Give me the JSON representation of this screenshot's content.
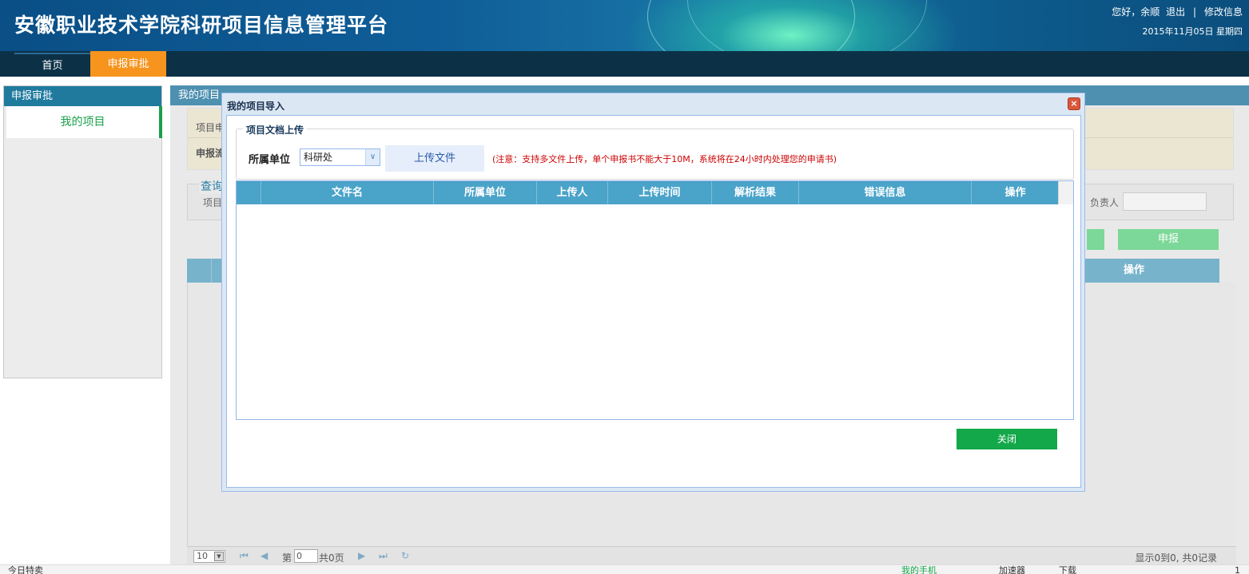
{
  "header": {
    "title": "安徽职业技术学院科研项目信息管理平台",
    "greeting": "您好，余顺",
    "logout": "退出",
    "separator": "|",
    "edit_info": "修改信息",
    "date": "2015年11月05日  星期四"
  },
  "nav": {
    "tabs": [
      {
        "label": "首页",
        "active": false
      },
      {
        "label": "申报审批",
        "active": true
      }
    ]
  },
  "sidebar": {
    "title": "申报审批",
    "items": [
      {
        "label": "我的项目",
        "active": true
      }
    ]
  },
  "main": {
    "title": "我的项目",
    "info_line1": "项目申",
    "info_line2": "申报流",
    "query_legend": "查询",
    "query_field_label": "项目",
    "owner_label": "负责人",
    "owner_value": "",
    "declare_button": "申报",
    "grid_op_header": "操作",
    "pager": {
      "page_size": "10",
      "page_prefix": "第",
      "page_value": "0",
      "page_total": "共0页",
      "summary": "显示0到0, 共0记录"
    }
  },
  "modal": {
    "title": "我的项目导入",
    "close_icon": "close-icon",
    "fieldset_legend": "项目文档上传",
    "unit_label": "所属单位",
    "unit_selected": "科研处",
    "upload_button": "上传文件",
    "note": "(注意：支持多文件上传，单个申报书不能大于10M，系统将在24小时内处理您的申请书)",
    "columns": [
      "文件名",
      "所属单位",
      "上传人",
      "上传时间",
      "解析结果",
      "错误信息",
      "操作"
    ],
    "rows": [],
    "close_button": "关闭"
  },
  "statusbar": {
    "left": "今日特卖",
    "items": [
      "我的手机",
      "加速器",
      "下载",
      "1"
    ]
  },
  "colors": {
    "header_blue": "#0f5d98",
    "nav_dark": "#0c3147",
    "active_tab": "#f7941d",
    "accent_green": "#13a84a",
    "grid_header": "#4aa3c9"
  }
}
